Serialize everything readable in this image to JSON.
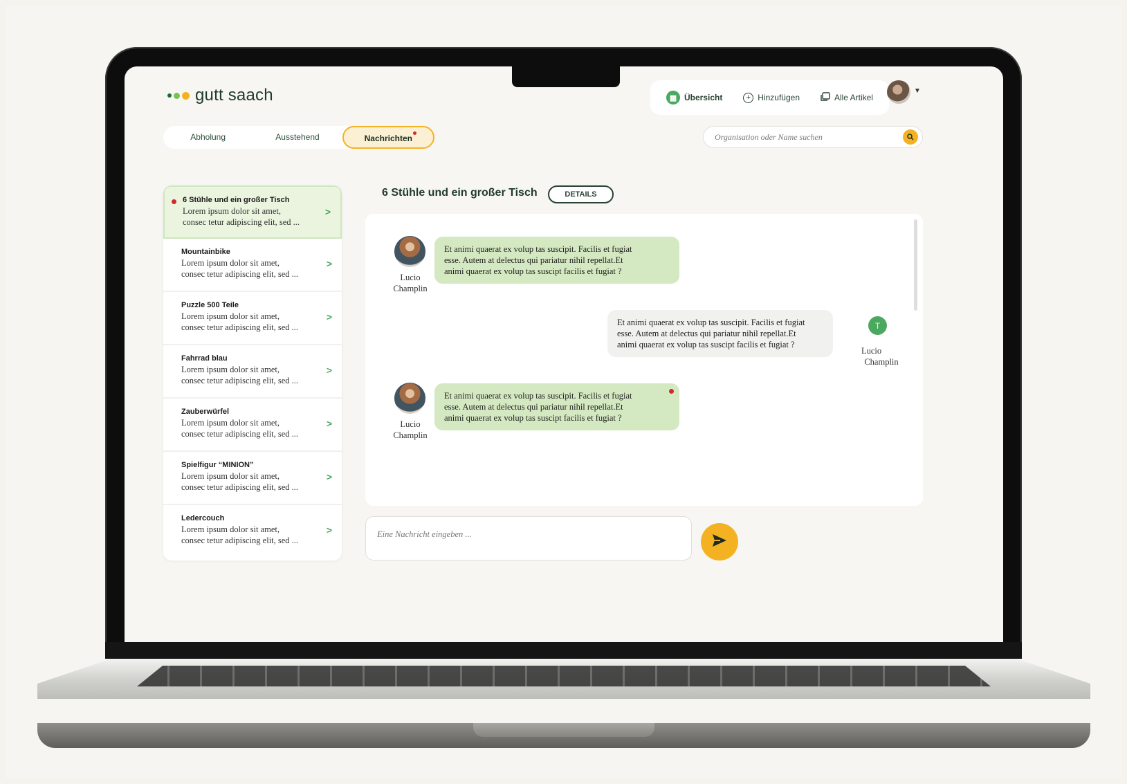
{
  "app": {
    "name": "gutt saach"
  },
  "topnav": {
    "items": [
      {
        "label": "Übersicht",
        "icon": "grid-icon",
        "active": true
      },
      {
        "label": "Hinzufügen",
        "icon": "plus-circle-icon",
        "active": false
      },
      {
        "label": "Alle Artikel",
        "icon": "articles-icon",
        "active": false
      }
    ]
  },
  "tabs": [
    {
      "label": "Abholung",
      "active": false
    },
    {
      "label": "Ausstehend",
      "active": false
    },
    {
      "label": "Nachrichten",
      "active": true,
      "badge": true
    }
  ],
  "search": {
    "placeholder": "Organisation oder Name suchen"
  },
  "conversations": [
    {
      "title": "6 Stühle und ein großer Tisch",
      "snippet_1": "Lorem ipsum dolor sit amet,",
      "snippet_2": "consec tetur adipiscing elit, sed ...",
      "unread": true,
      "active": true
    },
    {
      "title": "Mountainbike",
      "snippet_1": "Lorem ipsum dolor sit amet,",
      "snippet_2": "consec tetur adipiscing elit, sed ...",
      "unread": false,
      "active": false
    },
    {
      "title": "Puzzle 500 Teile",
      "snippet_1": "Lorem ipsum dolor sit amet,",
      "snippet_2": "consec tetur adipiscing elit, sed ...",
      "unread": false,
      "active": false
    },
    {
      "title": "Fahrrad blau",
      "snippet_1": "Lorem ipsum dolor sit amet,",
      "snippet_2": "consec tetur adipiscing elit, sed ...",
      "unread": false,
      "active": false
    },
    {
      "title": "Zauberwürfel",
      "snippet_1": "Lorem ipsum dolor sit amet,",
      "snippet_2": "consec tetur adipiscing elit, sed ...",
      "unread": false,
      "active": false
    },
    {
      "title": "Spielfigur “MINION”",
      "snippet_1": "Lorem ipsum dolor sit amet,",
      "snippet_2": "consec tetur adipiscing elit, sed ...",
      "unread": false,
      "active": false
    },
    {
      "title": "Ledercouch",
      "snippet_1": "Lorem ipsum dolor sit amet,",
      "snippet_2": "consec tetur adipiscing elit, sed ...",
      "unread": false,
      "active": false
    }
  ],
  "chat": {
    "title": "6 Stühle und ein großer Tisch",
    "details_label": "DETAILS",
    "messages": [
      {
        "direction": "in",
        "sender_first": "Lucio",
        "sender_last": "Champlin",
        "line_1": "Et animi quaerat ex volup tas suscipit. Facilis et fugiat",
        "line_2": "esse. Autem at delectus qui pariatur nihil repellat.Et",
        "line_3": "animi quaerat ex volup tas suscipt facilis et fugiat ?",
        "unread": false
      },
      {
        "direction": "out",
        "sender_first": "Lucio",
        "sender_last": "Champlin",
        "line_1": "Et animi quaerat ex volup tas suscipit. Facilis et fugiat",
        "line_2": "esse. Autem at delectus qui pariatur nihil repellat.Et",
        "line_3": "animi quaerat ex volup tas suscipt facilis et fugiat ?",
        "unread": false
      },
      {
        "direction": "in",
        "sender_first": "Lucio",
        "sender_last": "Champlin",
        "line_1": "Et animi quaerat ex volup tas suscipit. Facilis et fugiat",
        "line_2": "esse. Autem at delectus qui pariatur nihil repellat.Et",
        "line_3": "animi quaerat ex volup tas suscipt facilis et fugiat ?",
        "unread": true
      }
    ]
  },
  "composer": {
    "placeholder": "Eine Nachricht eingeben ..."
  },
  "colors": {
    "accent_yellow": "#f4b223",
    "accent_green": "#4aa85f",
    "bubble_in": "#d4e8c1",
    "bubble_out": "#f1f1ef",
    "unread_red": "#d02b2b"
  }
}
